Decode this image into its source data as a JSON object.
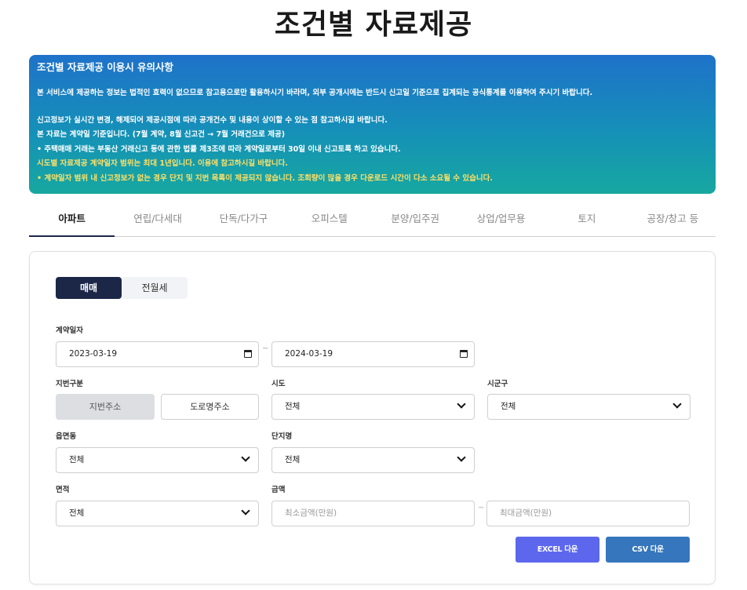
{
  "page": {
    "title": "조건별 자료제공"
  },
  "notice": {
    "title": "조건별 자료제공 이용시 유의사항",
    "lines": [
      "본 서비스에 제공하는 정보는 법적인 효력이 없으므로 참고용으로만 활용하시기 바라며, 외부 공개시에는 반드시 신고일 기준으로 집계되는 공식통계를 이용하여 주시기 바랍니다.",
      "신고정보가 실시간 변경, 해제되어 제공시점에 따라 공개건수 및 내용이 상이할 수 있는 점 참고하시길 바랍니다.",
      "본 자료는 계약일 기준입니다. (7월 계약, 8월 신고건 → 7월 거래건으로 제공)",
      "• 주택매매 거래는 부동산 거래신고 등에 관한 법률 제3조에 따라 계약일로부터 30일 이내 신고토록 하고 있습니다.",
      "시도별 자료제공 계약일자 범위는 최대 1년입니다. 이용에 참고하시길 바랍니다.",
      "• 계약일자 범위 내 신고정보가 없는 경우 단지 및 지번 목록이 제공되지 않습니다. 조회량이 많을 경우 다운로드 시간이 다소 소요될 수 있습니다."
    ]
  },
  "tabs": [
    "아파트",
    "연립/다세대",
    "단독/다가구",
    "오피스텔",
    "분양/입주권",
    "상업/업무용",
    "토지",
    "공장/창고 등"
  ],
  "trade_type": {
    "sale": "매매",
    "rent": "전월세"
  },
  "form": {
    "contract_date_label": "계약일자",
    "date_from": "2023-03-19",
    "date_to": "2024-03-19",
    "lot_type_label": "지번구분",
    "lot_address": "지번주소",
    "road_address": "도로명주소",
    "sido_label": "시도",
    "sido_value": "전체",
    "sigungu_label": "시군구",
    "sigungu_value": "전체",
    "eupmyeondong_label": "읍면동",
    "eupmyeondong_value": "전체",
    "complex_label": "단지명",
    "complex_value": "전체",
    "area_label": "면적",
    "area_value": "전체",
    "amount_label": "금액",
    "min_amount_placeholder": "최소금액(만원)",
    "max_amount_placeholder": "최대금액(만원)",
    "separator": "~"
  },
  "actions": {
    "excel": "EXCEL 다운",
    "csv": "CSV 다운"
  }
}
